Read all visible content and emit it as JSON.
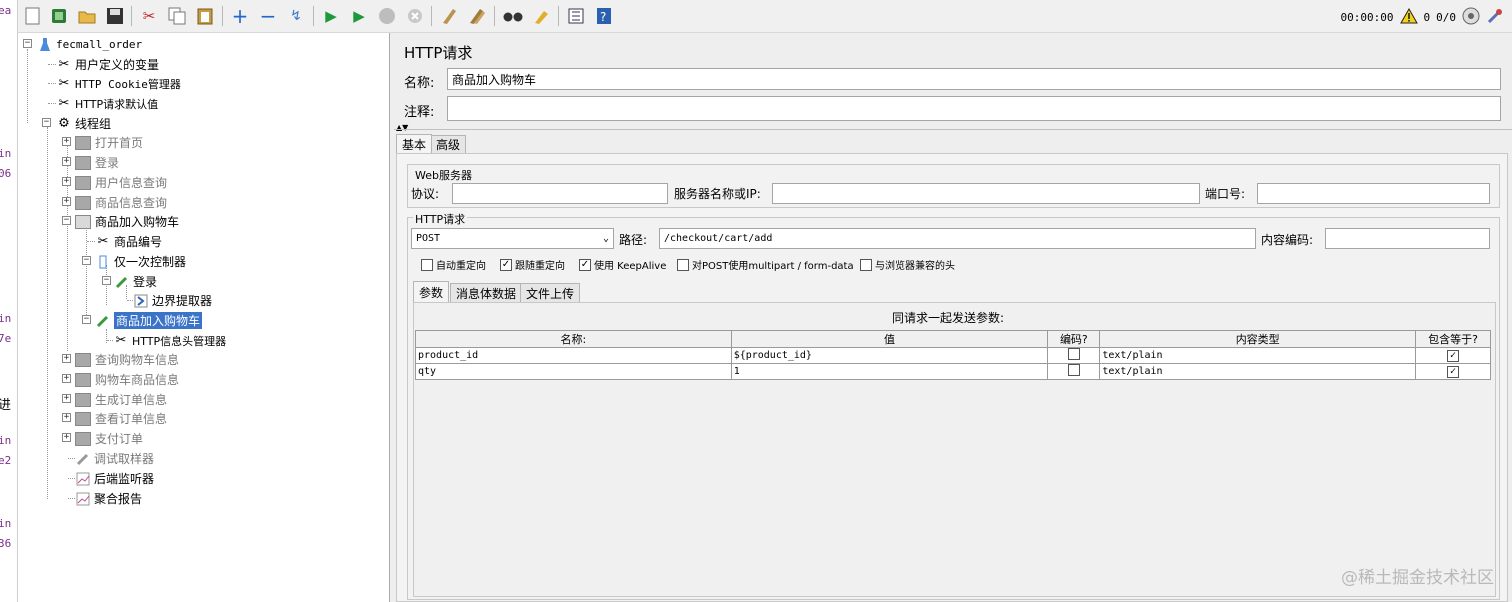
{
  "leftstrip": [
    {
      "t": "ea"
    },
    {
      "t": "in"
    },
    {
      "t": "06"
    },
    {
      "t": "in"
    },
    {
      "t": "7e"
    },
    {
      "t": "进"
    },
    {
      "t": "in"
    },
    {
      "t": "e2"
    },
    {
      "t": "in"
    },
    {
      "t": "36"
    }
  ],
  "toolbar": {
    "elapsed": "00:00:00",
    "warn_count": "0",
    "threads": "0/0"
  },
  "tree": {
    "root": "fecmall_order",
    "items": [
      {
        "label": "用户定义的变量"
      },
      {
        "label": "HTTP Cookie管理器"
      },
      {
        "label": "HTTP请求默认值"
      },
      {
        "label": "线程组"
      },
      {
        "label": "打开首页"
      },
      {
        "label": "登录"
      },
      {
        "label": "用户信息查询"
      },
      {
        "label": "商品信息查询"
      },
      {
        "label": "商品加入购物车"
      },
      {
        "label": "商品编号"
      },
      {
        "label": "仅一次控制器"
      },
      {
        "label": "登录"
      },
      {
        "label": "边界提取器"
      },
      {
        "label": "商品加入购物车"
      },
      {
        "label": "HTTP信息头管理器"
      },
      {
        "label": "查询购物车信息"
      },
      {
        "label": "购物车商品信息"
      },
      {
        "label": "生成订单信息"
      },
      {
        "label": "查看订单信息"
      },
      {
        "label": "支付订单"
      },
      {
        "label": "调试取样器"
      },
      {
        "label": "后端监听器"
      },
      {
        "label": "聚合报告"
      }
    ]
  },
  "form": {
    "title": "HTTP请求",
    "name_label": "名称:",
    "name_value": "商品加入购物车",
    "comment_label": "注释:",
    "comment_value": "",
    "tabs": [
      "基本",
      "高级"
    ],
    "web_server_title": "Web服务器",
    "protocol_label": "协议:",
    "server_label": "服务器名称或IP:",
    "port_label": "端口号:",
    "http_request_title": "HTTP请求",
    "method": "POST",
    "path_label": "路径:",
    "path_value": "/checkout/cart/add",
    "encoding_label": "内容编码:",
    "options": [
      {
        "label": "自动重定向",
        "checked": false
      },
      {
        "label": "跟随重定向",
        "checked": true
      },
      {
        "label": "使用 KeepAlive",
        "checked": true
      },
      {
        "label": "对POST使用multipart / form-data",
        "checked": false
      },
      {
        "label": "与浏览器兼容的头",
        "checked": false
      }
    ],
    "subtabs": [
      "参数",
      "消息体数据",
      "文件上传"
    ],
    "params_caption": "同请求一起发送参数:",
    "columns": [
      "名称:",
      "值",
      "编码?",
      "内容类型",
      "包含等于?"
    ],
    "rows": [
      {
        "name": "product_id",
        "value": "${product_id}",
        "encode": false,
        "ctype": "text/plain",
        "equals": true
      },
      {
        "name": "qty",
        "value": "1",
        "encode": false,
        "ctype": "text/plain",
        "equals": true
      }
    ]
  },
  "watermark": "@稀土掘金技术社区"
}
